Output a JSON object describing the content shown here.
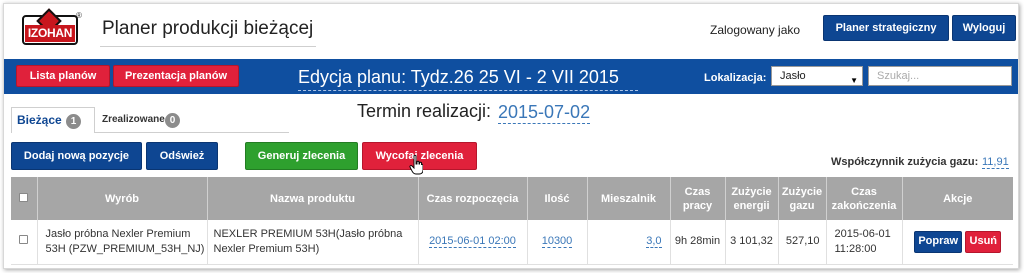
{
  "header": {
    "logo_text": "IZOHAN",
    "logo_mark": "®",
    "app_title": "Planer produkcji bieżącej",
    "login_label": "Zalogowany jako",
    "strategic_button": "Planer strategiczny",
    "logout_button": "Wyloguj"
  },
  "toolbar": {
    "plans_list_button": "Lista planów",
    "plans_presentation_button": "Prezentacja planów",
    "plan_title": "Edycja planu: Tydz.26 25 VI - 2 VII 2015",
    "location_label": "Lokalizacja:",
    "location_value": "Jasło",
    "search_placeholder": "Szukaj..."
  },
  "tabs": [
    {
      "label": "Bieżące",
      "count": "1",
      "active": true
    },
    {
      "label": "Zrealizowane",
      "count": "0",
      "active": false
    }
  ],
  "realization": {
    "label": "Termin realizacji:",
    "date": "2015-07-02"
  },
  "actions": {
    "add_button": "Dodaj nową pozycje",
    "refresh_button": "Odśwież",
    "generate_button": "Generuj zlecenia",
    "withdraw_button": "Wycofaj zlecenia"
  },
  "gas_factor": {
    "label": "Współczynnik zużycia gazu:",
    "value": "11,91"
  },
  "table": {
    "columns": [
      "Wyrób",
      "Nazwa produktu",
      "Czas rozpoczęcia",
      "Ilość",
      "Mieszalnik",
      "Czas pracy",
      "Zużycie energii",
      "Zużycie gazu",
      "Czas zakończenia",
      "Akcje"
    ],
    "rows": [
      {
        "product": "Jasło próbna Nexler Premium 53H (PZW_PREMIUM_53H_NJ)",
        "product_name": "NEXLER PREMIUM 53H(Jasło próbna Nexler Premium 53H)",
        "start_time": "2015-06-01 02:00",
        "quantity": "10300",
        "mixer": "3,0",
        "work_time": "9h 28min",
        "energy": "3 101,32",
        "gas": "527,10",
        "end_time": "2015-06-01 11:28:00",
        "edit_button": "Popraw",
        "delete_button": "Usuń"
      }
    ]
  },
  "colors": {
    "navy": "#0e4692",
    "blue_bar": "#0f4fa0",
    "red": "#e0213b",
    "green": "#2ea02e",
    "link": "#3a77b8",
    "table_header": "#a6a6a6"
  }
}
